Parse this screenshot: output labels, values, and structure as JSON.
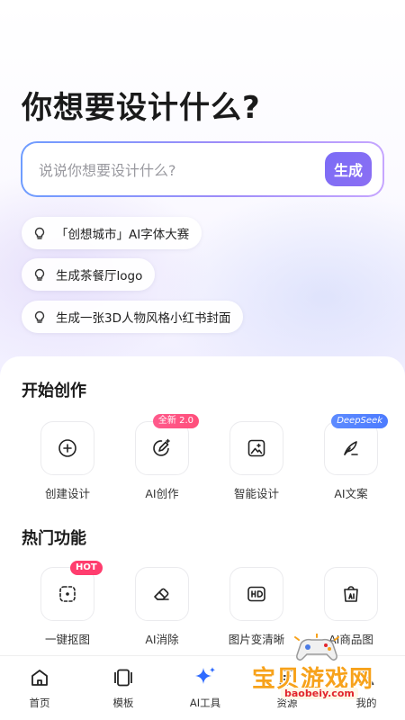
{
  "headline": "你想要设计什么?",
  "prompt": {
    "placeholder": "说说你想要设计什么?",
    "generate_label": "生成"
  },
  "suggestions": [
    "「创想城市」AI字体大赛",
    "生成茶餐厅logo",
    "生成一张3D人物风格小红书封面"
  ],
  "sections": {
    "start": {
      "title": "开始创作",
      "items": [
        {
          "label": "创建设计",
          "icon": "plus-circle-icon"
        },
        {
          "label": "AI创作",
          "icon": "ai-pen-icon",
          "badge": "全新 2.0"
        },
        {
          "label": "智能设计",
          "icon": "image-sparkle-icon"
        },
        {
          "label": "AI文案",
          "icon": "feather-icon",
          "badge": "DeepSeek"
        }
      ]
    },
    "hot": {
      "title": "热门功能",
      "items": [
        {
          "label": "一键抠图",
          "icon": "cutout-icon",
          "badge": "HOT"
        },
        {
          "label": "AI消除",
          "icon": "eraser-icon"
        },
        {
          "label": "图片变清晰",
          "icon": "hd-icon"
        },
        {
          "label": "AI商品图",
          "icon": "shopping-bag-ai-icon"
        }
      ]
    }
  },
  "tabbar": {
    "items": [
      {
        "label": "首页",
        "icon": "home-icon"
      },
      {
        "label": "模板",
        "icon": "template-icon"
      },
      {
        "label": "AI工具",
        "icon": "sparkle-icon"
      },
      {
        "label": "资源",
        "icon": "resource-icon"
      },
      {
        "label": "我的",
        "icon": "profile-icon"
      }
    ]
  },
  "watermark": {
    "title": "宝贝游戏网",
    "url": "baobeiy.com"
  },
  "colors": {
    "accent": "#7b6cf6",
    "hot_badge": "#ff3d6e",
    "deepseek_badge": "#4c7bff",
    "watermark_orange": "#f7a21b"
  }
}
